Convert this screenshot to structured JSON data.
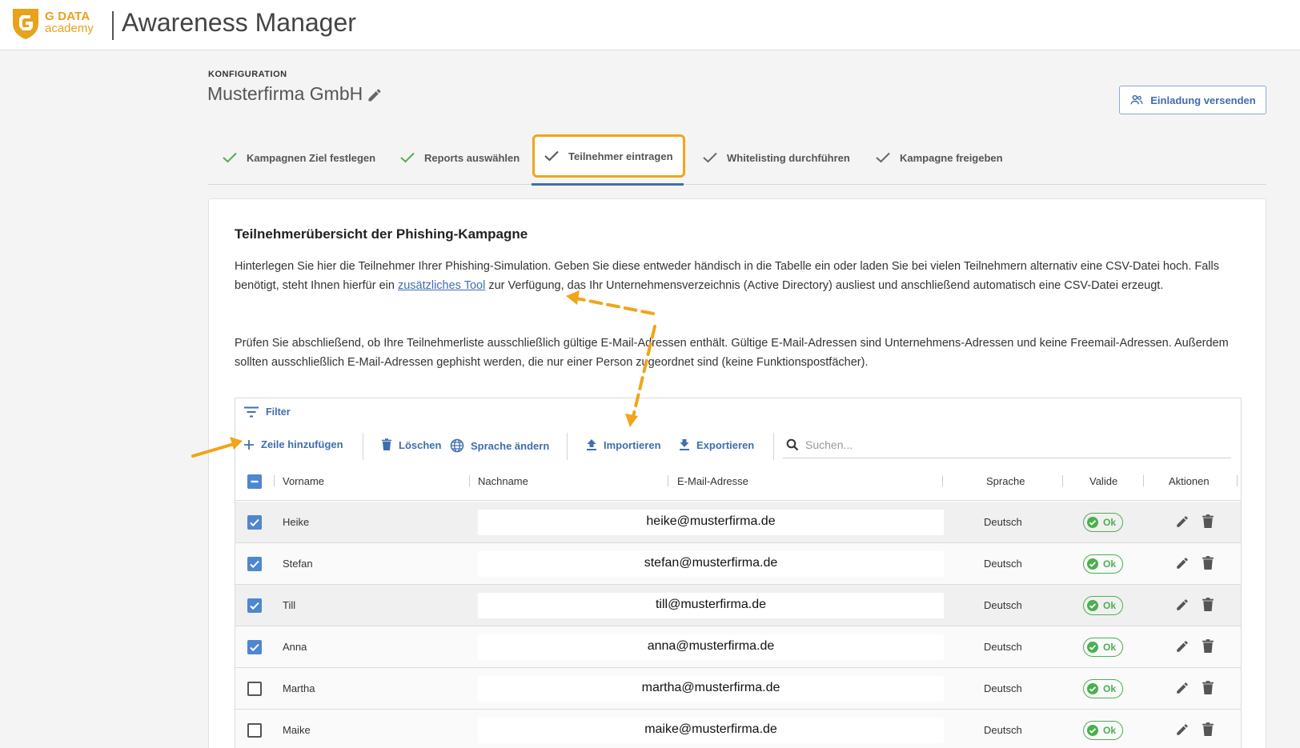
{
  "header": {
    "brand_line1": "G DATA",
    "brand_line2": "academy",
    "app_title": "Awareness Manager"
  },
  "config": {
    "section_label": "KONFIGURATION",
    "company_name": "Musterfirma GmbH",
    "invite_label": "Einladung versenden"
  },
  "steps": [
    {
      "label": "Kampagnen Ziel festlegen"
    },
    {
      "label": "Reports auswählen"
    },
    {
      "label": "Teilnehmer eintragen"
    },
    {
      "label": "Whitelisting durchführen"
    },
    {
      "label": "Kampagne freigeben"
    }
  ],
  "card": {
    "title": "Teilnehmerübersicht der Phishing-Kampagne",
    "para1_before": "Hinterlegen Sie hier die Teilnehmer Ihrer Phishing-Simulation. Geben Sie diese entweder händisch in die Tabelle ein oder laden Sie bei vielen Teilnehmern alternativ eine CSV-Datei hoch. Falls benötigt, steht Ihnen hierfür ein ",
    "para1_link": "zusätzliches Tool",
    "para1_after": " zur Verfügung, das Ihr Unternehmensverzeichnis (Active Directory) ausliest und anschließend automatisch eine CSV-Datei erzeugt.",
    "para2": "Prüfen Sie abschließend, ob Ihre Teilnehmerliste ausschließlich gültige E-Mail-Adressen enthält. Gültige E-Mail-Adressen sind Unternehmens-Adressen und keine Freemail-Adressen. Außerdem sollten ausschließlich E-Mail-Adressen gephisht werden, die nur einer Person zugeordnet sind (keine Funktionspostfächer)."
  },
  "toolbar": {
    "filter": "Filter",
    "add_row": "Zeile hinzufügen",
    "delete": "Löschen",
    "change_language": "Sprache ändern",
    "import": "Importieren",
    "export": "Exportieren",
    "search_placeholder": "Suchen..."
  },
  "table": {
    "columns": [
      "Vorname",
      "Nachname",
      "E-Mail-Adresse",
      "Sprache",
      "Valide",
      "Aktionen"
    ],
    "rows": [
      {
        "first_name": "Heike",
        "email": "heike@musterfirma.de",
        "language": "Deutsch",
        "valid": "Ok",
        "selected": true
      },
      {
        "first_name": "Stefan",
        "email": "stefan@musterfirma.de",
        "language": "Deutsch",
        "valid": "Ok",
        "selected": true
      },
      {
        "first_name": "Till",
        "email": "till@musterfirma.de",
        "language": "Deutsch",
        "valid": "Ok",
        "selected": true
      },
      {
        "first_name": "Anna",
        "email": "anna@musterfirma.de",
        "language": "Deutsch",
        "valid": "Ok",
        "selected": true
      },
      {
        "first_name": "Martha",
        "email": "martha@musterfirma.de",
        "language": "Deutsch",
        "valid": "Ok",
        "selected": false
      },
      {
        "first_name": "Maike",
        "email": "maike@musterfirma.de",
        "language": "Deutsch",
        "valid": "Ok",
        "selected": false
      }
    ]
  },
  "colors": {
    "accent_blue": "#3f6ead",
    "highlight_orange": "#f0a51a",
    "valid_green": "#4caf50",
    "brand_orange": "#e8a21b"
  }
}
